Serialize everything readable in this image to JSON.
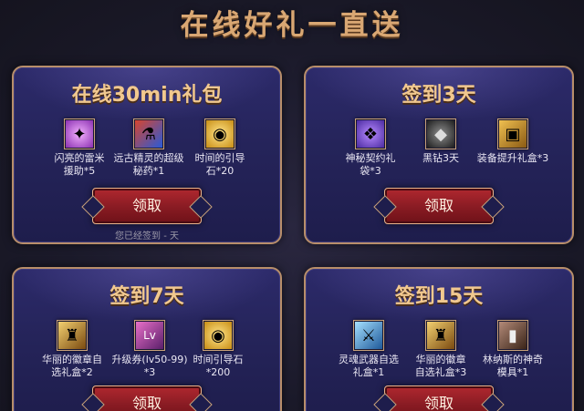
{
  "page": {
    "title": "在线好礼一直送"
  },
  "panels": [
    {
      "title": "在线30min礼包",
      "items": [
        {
          "label": "闪亮的雷米援助*5",
          "icon": "purple-crystal-icon",
          "color": "#c25be0"
        },
        {
          "label": "远古精灵的超级秘药*1",
          "icon": "potion-icon",
          "color": "#3a8fd6"
        },
        {
          "label": "时间的引导石*20",
          "icon": "golden-egg-icon",
          "color": "#e9c23b"
        }
      ],
      "button_label": "领取",
      "note": "您已经签到 - 天"
    },
    {
      "title": "签到3天",
      "items": [
        {
          "label": "神秘契约礼袋*3",
          "icon": "mystic-bag-icon",
          "color": "#8b5be0"
        },
        {
          "label": "黑钻3天",
          "icon": "black-diamond-icon",
          "color": "#6d6d6d"
        },
        {
          "label": "装备提升礼盒*3",
          "icon": "gift-box-icon",
          "color": "#d89b2f"
        }
      ],
      "button_label": "领取"
    },
    {
      "title": "签到7天",
      "items": [
        {
          "label": "华丽的徽章自选礼盒*2",
          "icon": "emblem-box-icon",
          "color": "#e0b344"
        },
        {
          "label": "升级券(lv50-99) *3",
          "icon": "level-ticket-icon",
          "color": "#c14f9d"
        },
        {
          "label": "时间引导石*200",
          "icon": "golden-egg-icon",
          "color": "#e9c23b"
        }
      ],
      "button_label": "领取"
    },
    {
      "title": "签到15天",
      "items": [
        {
          "label": "灵魂武器自选礼盒*1",
          "icon": "soul-weapon-box-icon",
          "color": "#4aa6e0"
        },
        {
          "label": "华丽的徽章自选礼盒*3",
          "icon": "emblem-box-icon",
          "color": "#e0b344"
        },
        {
          "label": "林纳斯的神奇模具*1",
          "icon": "mold-icon",
          "color": "#7d5a4a"
        }
      ],
      "button_label": "领取"
    }
  ]
}
